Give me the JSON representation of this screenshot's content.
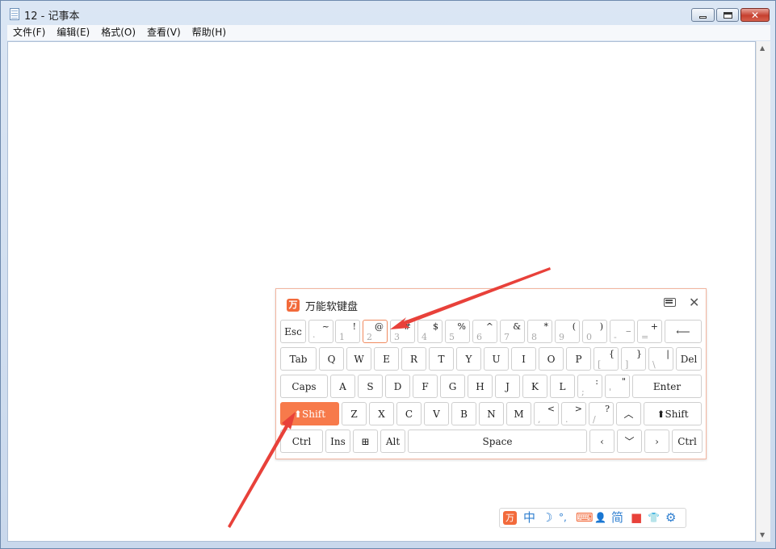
{
  "window": {
    "title": "12 - 记事本"
  },
  "menu": {
    "items": [
      "文件(F)",
      "编辑(E)",
      "格式(O)",
      "查看(V)",
      "帮助(H)"
    ]
  },
  "keyboard": {
    "title": "万能软键盘",
    "logo": "万",
    "row1": [
      {
        "name": "esc",
        "main": "Esc"
      },
      {
        "name": "backquote",
        "top": "~",
        "bot": "·"
      },
      {
        "name": "1",
        "top": "!",
        "bot": "1"
      },
      {
        "name": "2",
        "top": "@",
        "bot": "2"
      },
      {
        "name": "3",
        "top": "#",
        "bot": "3"
      },
      {
        "name": "4",
        "top": "$",
        "bot": "4"
      },
      {
        "name": "5",
        "top": "%",
        "bot": "5"
      },
      {
        "name": "6",
        "top": "^",
        "bot": "6"
      },
      {
        "name": "7",
        "top": "&",
        "bot": "7"
      },
      {
        "name": "8",
        "top": "*",
        "bot": "8"
      },
      {
        "name": "9",
        "top": "(",
        "bot": "9"
      },
      {
        "name": "0",
        "top": ")",
        "bot": "0"
      },
      {
        "name": "minus",
        "top": "_",
        "bot": "-"
      },
      {
        "name": "equal",
        "top": "+",
        "bot": "="
      },
      {
        "name": "backspace",
        "main": "⟵"
      }
    ],
    "row2": [
      {
        "name": "tab",
        "main": "Tab"
      },
      {
        "name": "q",
        "main": "Q"
      },
      {
        "name": "w",
        "main": "W"
      },
      {
        "name": "e",
        "main": "E"
      },
      {
        "name": "r",
        "main": "R"
      },
      {
        "name": "t",
        "main": "T"
      },
      {
        "name": "y",
        "main": "Y"
      },
      {
        "name": "u",
        "main": "U"
      },
      {
        "name": "i",
        "main": "I"
      },
      {
        "name": "o",
        "main": "O"
      },
      {
        "name": "p",
        "main": "P"
      },
      {
        "name": "lbracket",
        "top": "{",
        "bot": "["
      },
      {
        "name": "rbracket",
        "top": "}",
        "bot": "]"
      },
      {
        "name": "backslash",
        "top": "|",
        "bot": "\\"
      },
      {
        "name": "del",
        "main": "Del"
      }
    ],
    "row3": [
      {
        "name": "caps",
        "main": "Caps"
      },
      {
        "name": "a",
        "main": "A"
      },
      {
        "name": "s",
        "main": "S"
      },
      {
        "name": "d",
        "main": "D"
      },
      {
        "name": "f",
        "main": "F"
      },
      {
        "name": "g",
        "main": "G"
      },
      {
        "name": "h",
        "main": "H"
      },
      {
        "name": "j",
        "main": "J"
      },
      {
        "name": "k",
        "main": "K"
      },
      {
        "name": "l",
        "main": "L"
      },
      {
        "name": "semicolon",
        "top": ":",
        "bot": ";"
      },
      {
        "name": "quote",
        "top": "\"",
        "bot": "'"
      },
      {
        "name": "enter",
        "main": "Enter"
      }
    ],
    "row4": [
      {
        "name": "shift-left",
        "main": "⬆Shift"
      },
      {
        "name": "z",
        "main": "Z"
      },
      {
        "name": "x",
        "main": "X"
      },
      {
        "name": "c",
        "main": "C"
      },
      {
        "name": "v",
        "main": "V"
      },
      {
        "name": "b",
        "main": "B"
      },
      {
        "name": "n",
        "main": "N"
      },
      {
        "name": "m",
        "main": "M"
      },
      {
        "name": "comma",
        "top": "<",
        "bot": ","
      },
      {
        "name": "period",
        "top": ">",
        "bot": "."
      },
      {
        "name": "slash",
        "top": "?",
        "bot": "/"
      },
      {
        "name": "arrow-up",
        "main": "︿"
      },
      {
        "name": "shift-right",
        "main": "⬆Shift"
      }
    ],
    "row5": [
      {
        "name": "ctrl-left",
        "main": "Ctrl"
      },
      {
        "name": "ins",
        "main": "Ins"
      },
      {
        "name": "win",
        "main": "⊞"
      },
      {
        "name": "alt",
        "main": "Alt"
      },
      {
        "name": "space",
        "main": "Space"
      },
      {
        "name": "arrow-left",
        "main": "‹"
      },
      {
        "name": "arrow-down",
        "main": "﹀"
      },
      {
        "name": "arrow-right",
        "main": "›"
      },
      {
        "name": "ctrl-right",
        "main": "Ctrl"
      }
    ],
    "active_key": "shift-left",
    "hover_key": "2"
  },
  "ime_toolbar": {
    "logo": "万",
    "mode": "中",
    "moon": "☽",
    "punct": "°,",
    "keyboard": "⌨",
    "user": "👤",
    "simplified": "简",
    "video": "■",
    "skin": "👕",
    "settings": "⚙",
    "colors": {
      "accent": "#f26a3b",
      "blue": "#2f7fd0"
    }
  },
  "colors": {
    "accent": "#f77a4b",
    "arrow": "#e8413a"
  }
}
